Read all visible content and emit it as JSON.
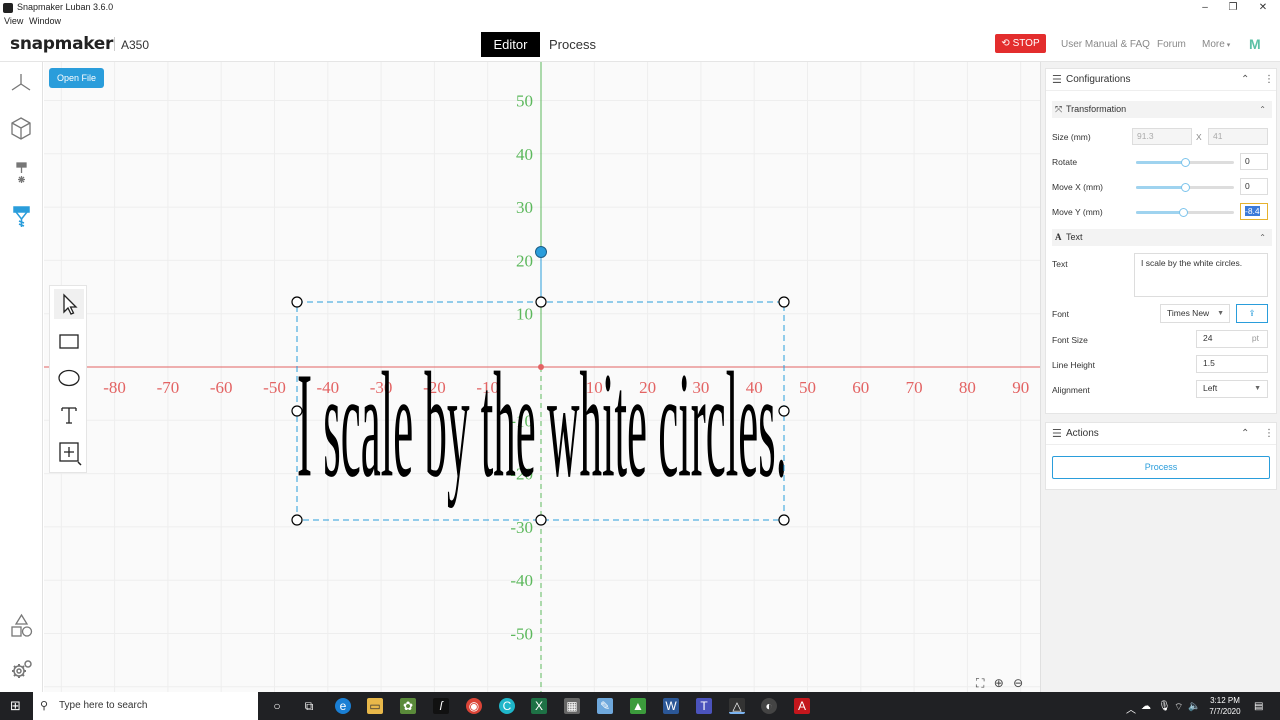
{
  "window": {
    "title": "Snapmaker Luban 3.6.0",
    "minimize": "–",
    "maximize": "❐",
    "close": "✕"
  },
  "menu": [
    "View",
    "Window"
  ],
  "header": {
    "logo": "snapmaker",
    "model": "A350",
    "tabs": {
      "editor": "Editor",
      "process": "Process"
    },
    "stop": "STOP",
    "links": [
      "User Manual & FAQ",
      "Forum",
      "More"
    ],
    "m_logo": "M"
  },
  "canvas": {
    "open_file": "Open File",
    "x_ticks": [
      "-80",
      "-70",
      "-60",
      "-50",
      "-40",
      "-30",
      "-20",
      "-10",
      "10",
      "20",
      "30",
      "40",
      "50",
      "60",
      "70",
      "80",
      "90"
    ],
    "y_ticks": [
      "50",
      "40",
      "30",
      "20",
      "10",
      "-10",
      "-20",
      "-30",
      "-40",
      "-50"
    ],
    "text_content": "I scale by the white circles.",
    "accent_x": "#e36363",
    "accent_y": "#5cb85c",
    "selection_color": "#2a9ddb"
  },
  "config": {
    "title": "Configurations",
    "transformation": {
      "title": "Transformation",
      "size_label": "Size (mm)",
      "size_w": "91.3",
      "size_x": "X",
      "size_h": "41",
      "rotate_label": "Rotate",
      "rotate": "0",
      "movex_label": "Move X (mm)",
      "movex": "0",
      "movey_label": "Move Y (mm)",
      "movey": "-8.4",
      "rotate_level": 0.5,
      "movex_level": 0.5,
      "movey_level": 0.48
    },
    "text": {
      "title": "Text",
      "text_label": "Text",
      "text_value": "I scale by the white circles.",
      "font_label": "Font",
      "font_value": "Times New",
      "fontsize_label": "Font Size",
      "fontsize": "24",
      "fontsize_unit": "pt",
      "lineheight_label": "Line Height",
      "lineheight": "1.5",
      "alignment_label": "Alignment",
      "alignment": "Left"
    }
  },
  "actions": {
    "title": "Actions",
    "process": "Process"
  },
  "taskbar": {
    "search_placeholder": "Type here to search",
    "time": "3:12 PM",
    "date": "7/7/2020"
  }
}
